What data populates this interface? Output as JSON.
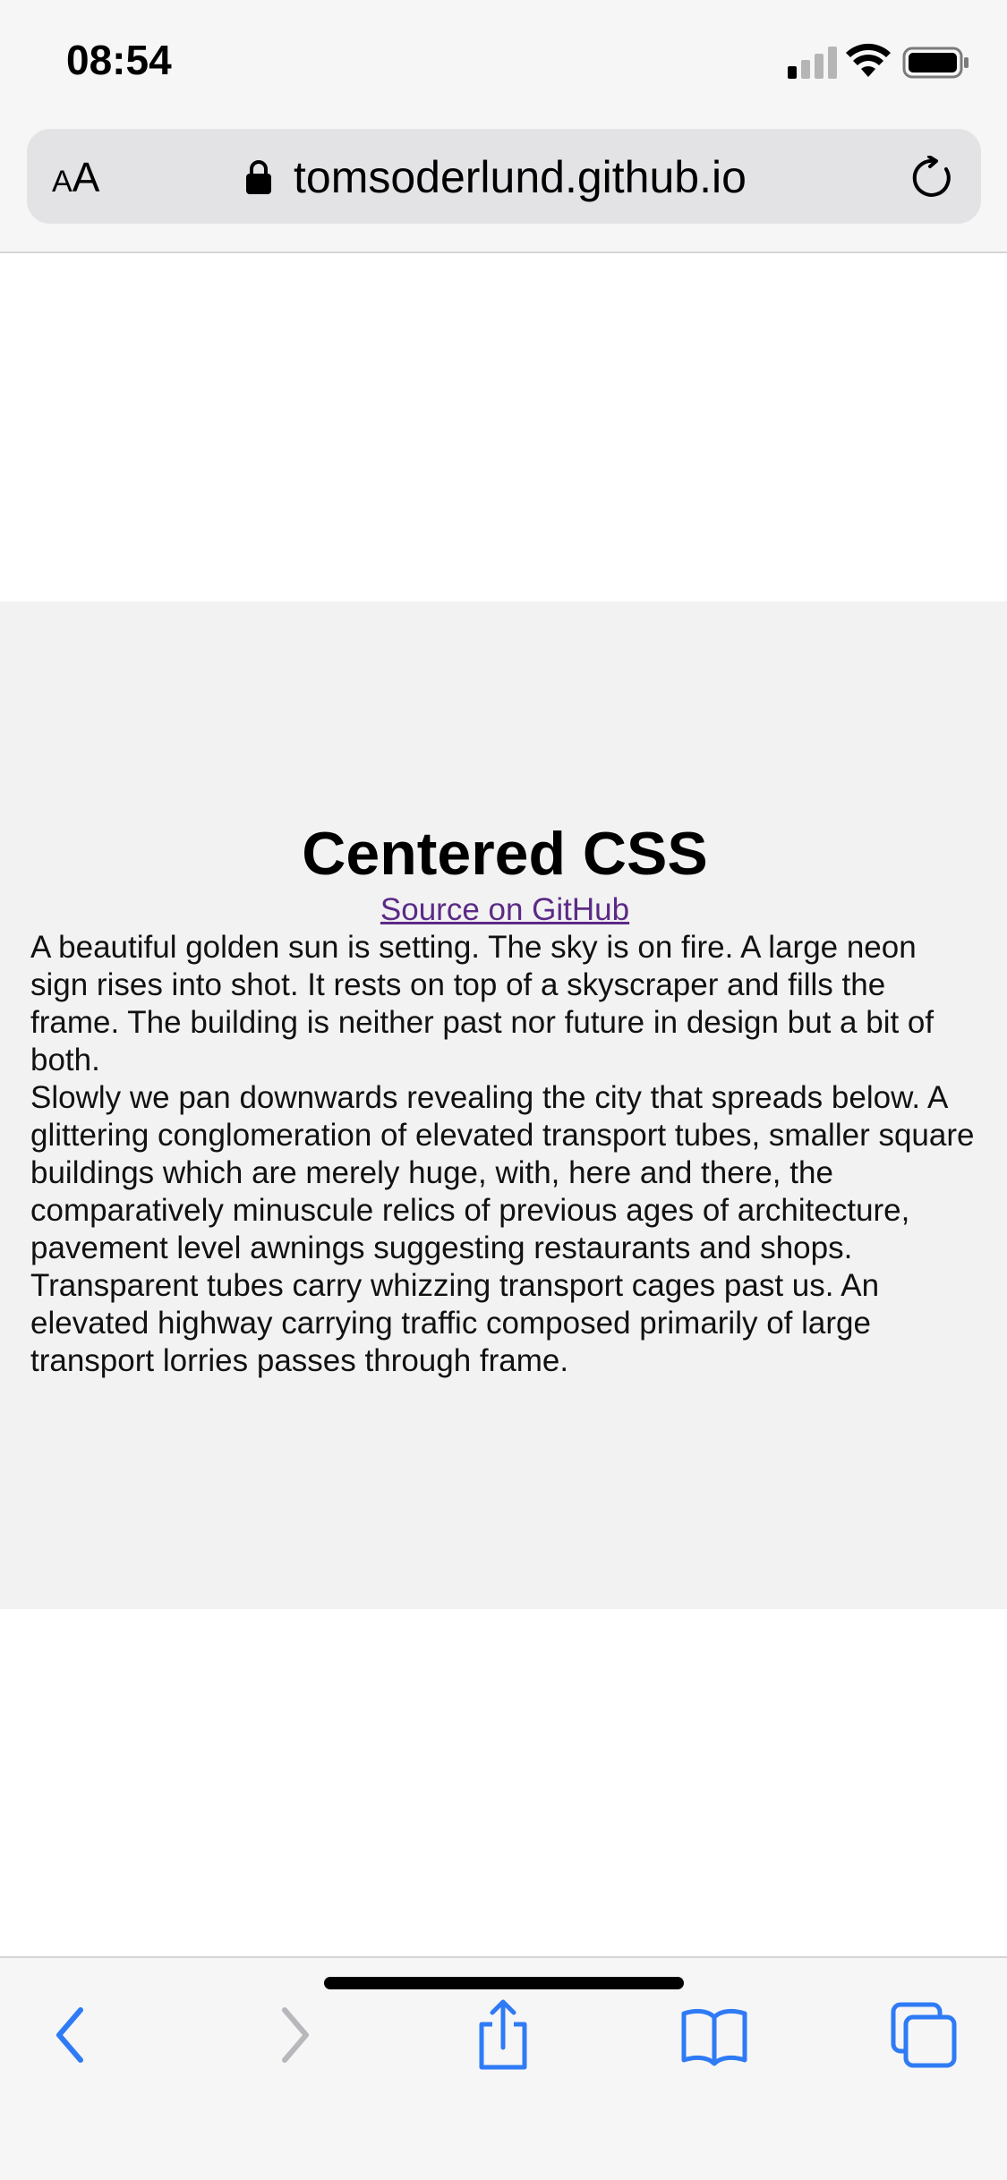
{
  "status_bar": {
    "time": "08:54"
  },
  "browser": {
    "aa_small": "A",
    "aa_large": "A",
    "url": "tomsoderlund.github.io",
    "accent_color": "#2f7bf5"
  },
  "content": {
    "title": "Centered CSS",
    "source_link": "Source on GitHub",
    "paragraphs": [
      "A beautiful golden sun is setting. The sky is on fire. A large neon sign rises into shot. It rests on top of a skyscraper and fills the frame. The building is neither past nor future in design but a bit of both.",
      "Slowly we pan downwards revealing the city that spreads below. A glittering conglomeration of elevated transport tubes, smaller square buildings which are merely huge, with, here and there, the comparatively minuscule relics of previous ages of architecture, pavement level awnings suggesting restaurants and shops. Transparent tubes carry whizzing transport cages past us. An elevated highway carrying traffic composed primarily of large transport lorries passes through frame."
    ]
  },
  "toolbar": {
    "icons": [
      "back-icon",
      "forward-icon",
      "share-icon",
      "bookmarks-icon",
      "tabs-icon"
    ]
  }
}
